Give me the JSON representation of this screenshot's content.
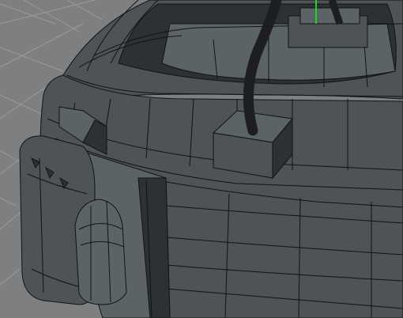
{
  "viewport": {
    "background_color": "#7e7f80",
    "grid_line_color": "#9a9b9c",
    "model_surface_color": "#4d5357",
    "model_surface_light_color": "#5c6367",
    "model_shadow_color": "#2d3134",
    "wireframe_color": "#111314",
    "cable_color": "#1d1e1f",
    "y_axis_color": "#1fd61f"
  },
  "scene": {
    "object_description_icon": "3d-mesh-icon",
    "components": [
      "outer-ring",
      "inner-rim",
      "cable",
      "cable-socket",
      "side-panel",
      "rounded-cap",
      "vent-block"
    ]
  }
}
